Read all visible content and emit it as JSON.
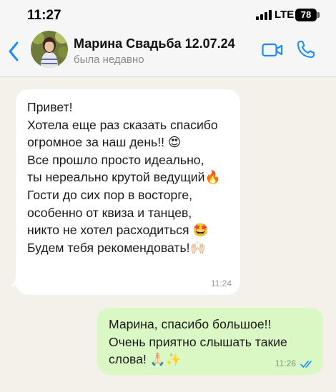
{
  "status_bar": {
    "time": "11:27",
    "network": "LTE",
    "battery": "78"
  },
  "header": {
    "contact_name": "Марина Свадьба 12.07.24",
    "contact_status": "была недавно",
    "icons": [
      "chevron-left-icon",
      "avatar",
      "video-camera-icon",
      "phone-icon"
    ],
    "accent_color": "#1a8cff"
  },
  "messages": [
    {
      "direction": "incoming",
      "lines": [
        "Привет!",
        "Хотела еще раз сказать спасибо",
        "огромное за наш день!! 😍",
        "Все прошло просто идеально,",
        "ты нереально крутой ведущий🔥",
        "Гости до сих пор в восторге,",
        "особенно от квиза и танцев,",
        "никто не хотел расходиться 🤩",
        "Будем тебя рекомендовать!🙌🏻"
      ],
      "time": "11:24"
    },
    {
      "direction": "outgoing",
      "lines": [
        "Марина, спасибо большое!!",
        "Очень приятно слышать такие",
        "слова! 🙏🏻✨"
      ],
      "time": "11:26",
      "read": "double-check-icon"
    }
  ],
  "colors": {
    "incoming_bubble": "#ffffff",
    "outgoing_bubble": "#d9f8c4",
    "chat_background": "#f4f0ea",
    "read_check": "#1a8cff"
  }
}
